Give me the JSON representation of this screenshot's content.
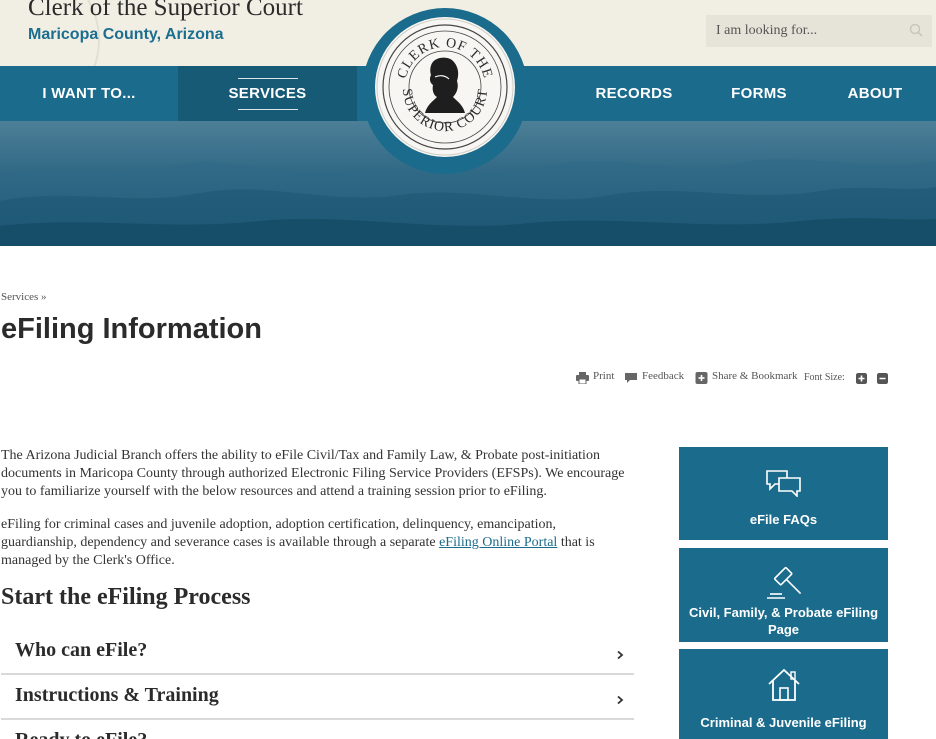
{
  "header": {
    "title": "Clerk of the Superior Court",
    "subtitle": "Maricopa County, Arizona",
    "search_placeholder": "I am looking for..."
  },
  "nav": {
    "items": [
      {
        "label": "I WANT TO..."
      },
      {
        "label": "SERVICES"
      },
      {
        "label": "RECORDS"
      },
      {
        "label": "FORMS"
      },
      {
        "label": "ABOUT"
      }
    ]
  },
  "seal": {
    "main_text_top": "CLERK OF THE",
    "main_text_bottom": "SUPERIOR COURT"
  },
  "breadcrumb": {
    "parent": "Services",
    "separator": "»"
  },
  "page": {
    "title": "eFiling Information"
  },
  "tools": {
    "print": "Print",
    "feedback": "Feedback",
    "share": "Share & Bookmark",
    "font_size": "Font Size:"
  },
  "content": {
    "para1": "The Arizona Judicial Branch offers the ability to eFile Civil/Tax and Family Law, & Probate post-initiation documents in Maricopa County through authorized Electronic Filing Service Providers (EFSPs). We encourage you to familiarize yourself with the below resources and attend a training session prior to eFiling.",
    "para2_before": "eFiling for criminal cases and juvenile adoption, adoption certification, delinquency, emancipation, guardianship, dependency and severance cases is available through a separate ",
    "para2_link": "eFiling Online Portal",
    "para2_after": " that is managed by the Clerk's Office.",
    "section_title": "Start the eFiling Process",
    "accordion": [
      {
        "label": "Who can eFile?"
      },
      {
        "label": "Instructions & Training"
      },
      {
        "label": "Ready to eFile?"
      }
    ]
  },
  "tiles": [
    {
      "label": "eFile FAQs",
      "icon": "chat-bubbles-icon"
    },
    {
      "label": "Civil, Family, & Probate eFiling Page",
      "icon": "gavel-icon"
    },
    {
      "label": "Criminal & Juvenile eFiling",
      "icon": "house-icon"
    }
  ],
  "colors": {
    "primary": "#1b6b8c",
    "active_nav": "#165a76",
    "header_bg": "#f1efe4"
  }
}
